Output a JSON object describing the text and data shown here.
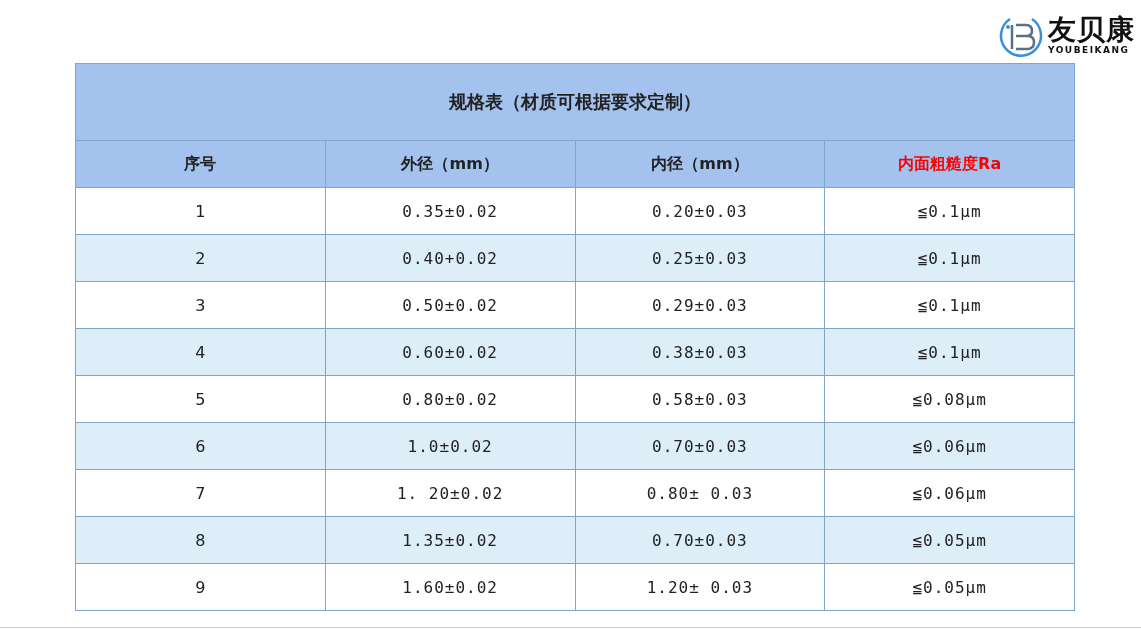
{
  "logo": {
    "name": "友贝康",
    "subtitle": "YOUBEIKANG"
  },
  "table": {
    "title": "规格表（材质可根据要求定制）",
    "columns": [
      {
        "label": "序号",
        "highlighted": false
      },
      {
        "label": "外径（mm）",
        "highlighted": false
      },
      {
        "label": "内径（mm）",
        "highlighted": false
      },
      {
        "label": "内面粗糙度Ra",
        "highlighted": true
      }
    ],
    "rows": [
      [
        "1",
        "0.35±0.02",
        "0.20±0.03",
        "≦0.1μm"
      ],
      [
        "2",
        "0.40+0.02",
        "0.25±0.03",
        "≦0.1μm"
      ],
      [
        "3",
        "0.50±0.02",
        "0.29±0.03",
        "≦0.1μm"
      ],
      [
        "4",
        "0.60±0.02",
        "0.38±0.03",
        "≦0.1μm"
      ],
      [
        "5",
        "0.80±0.02",
        "0.58±0.03",
        "≦0.08μm"
      ],
      [
        "6",
        "1.0±0.02",
        "0.70±0.03",
        "≦0.06μm"
      ],
      [
        "7",
        "1. 20±0.02",
        "0.80± 0.03",
        "≦0.06μm"
      ],
      [
        "8",
        "1.35±0.02",
        "0.70±0.03",
        "≦0.05μm"
      ],
      [
        "9",
        "1.60±0.02",
        "1.20± 0.03",
        "≦0.05μm"
      ]
    ]
  }
}
